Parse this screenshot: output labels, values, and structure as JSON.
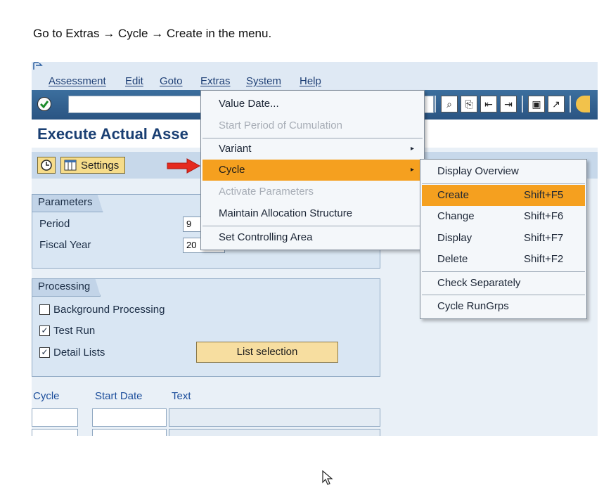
{
  "instruction": "Go to Extras → Cycle → Create in the menu.",
  "menubar": {
    "items": [
      "Assessment",
      "Edit",
      "Goto",
      "Extras",
      "System",
      "Help"
    ]
  },
  "page_title": "Execute Actual Asse",
  "appbar": {
    "settings_label": "Settings"
  },
  "parameters": {
    "group_label": "Parameters",
    "period_label": "Period",
    "period_value": "9",
    "fiscal_year_label": "Fiscal Year",
    "fiscal_year_value": "20"
  },
  "processing": {
    "group_label": "Processing",
    "background_label": "Background Processing",
    "background_checked": false,
    "test_run_label": "Test Run",
    "test_run_checked": true,
    "detail_lists_label": "Detail Lists",
    "detail_lists_checked": true,
    "list_selection_label": "List selection"
  },
  "table": {
    "headers": [
      "Cycle",
      "Start Date",
      "Text"
    ]
  },
  "extras_menu": {
    "items": [
      {
        "label": "Value Date...",
        "disabled": false
      },
      {
        "label": "Start Period of Cumulation",
        "disabled": true
      },
      {
        "label": "Variant",
        "disabled": false,
        "submenu": true
      },
      {
        "label": "Cycle",
        "disabled": false,
        "submenu": true,
        "highlighted": true
      },
      {
        "label": "Activate Parameters",
        "disabled": true
      },
      {
        "label": "Maintain Allocation Structure",
        "disabled": false
      },
      {
        "label": "Set Controlling Area",
        "disabled": false
      }
    ]
  },
  "cycle_submenu": {
    "items": [
      {
        "label": "Display Overview",
        "shortcut": ""
      },
      {
        "label": "Create",
        "shortcut": "Shift+F5",
        "highlighted": true
      },
      {
        "label": "Change",
        "shortcut": "Shift+F6"
      },
      {
        "label": "Display",
        "shortcut": "Shift+F7"
      },
      {
        "label": "Delete",
        "shortcut": "Shift+F2"
      },
      {
        "label": "Check Separately",
        "shortcut": ""
      },
      {
        "label": "Cycle RunGrps",
        "shortcut": ""
      }
    ]
  },
  "colors": {
    "highlight": "#f5a01f",
    "title": "#1a3f73",
    "toolbar": "#2a5482"
  },
  "icons": [
    "enter-icon",
    "execute-icon",
    "settings-icon",
    "red-arrow-icon",
    "mouse-cursor-icon",
    "submenu-arrow-icon"
  ]
}
